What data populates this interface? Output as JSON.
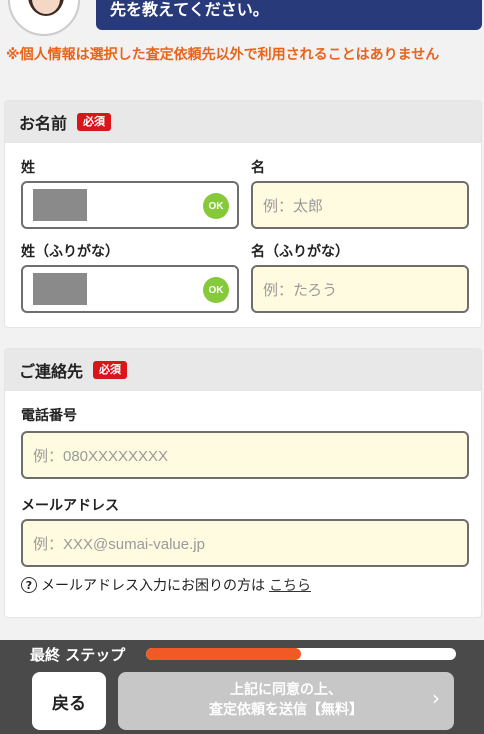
{
  "speech": {
    "text": "先を教えてください。"
  },
  "notice": "※個人情報は選択した査定依頼先以外で利用されることはありません",
  "name_section": {
    "title": "お名前",
    "required": "必須",
    "last_label": "姓",
    "first_label": "名",
    "last_ok": "OK",
    "first_placeholder": "例：太郎",
    "last_kana_label": "姓（ふりがな）",
    "first_kana_label": "名（ふりがな）",
    "last_kana_ok": "OK",
    "first_kana_placeholder": "例：たろう"
  },
  "contact_section": {
    "title": "ご連絡先",
    "required": "必須",
    "phone_label": "電話番号",
    "phone_placeholder": "例：080XXXXXXXX",
    "email_label": "メールアドレス",
    "email_placeholder": "例：XXX@sumai-value.jp",
    "help_icon": "?",
    "help_text": "メールアドレス入力にお困りの方は",
    "help_link": "こちら"
  },
  "footer": {
    "step_label": "最終 ステップ",
    "progress": 0.5,
    "back_label": "戻る",
    "submit_line1": "上記に同意の上、",
    "submit_line2": "査定依頼を送信【無料】",
    "submit_chevron": "›"
  },
  "colors": {
    "accent": "#e8641b",
    "header_blue": "#283a7a",
    "required_red": "#d8151b",
    "ok_green": "#86c93a",
    "progress_orange": "#f15a24"
  }
}
